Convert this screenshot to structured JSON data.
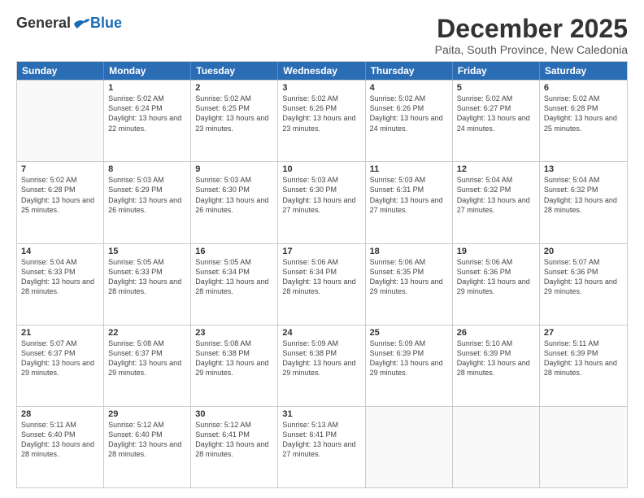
{
  "logo": {
    "general": "General",
    "blue": "Blue"
  },
  "title": "December 2025",
  "subtitle": "Paita, South Province, New Caledonia",
  "days": [
    "Sunday",
    "Monday",
    "Tuesday",
    "Wednesday",
    "Thursday",
    "Friday",
    "Saturday"
  ],
  "weeks": [
    [
      {
        "day": "",
        "sunrise": "",
        "sunset": "",
        "daylight": ""
      },
      {
        "day": "1",
        "sunrise": "Sunrise: 5:02 AM",
        "sunset": "Sunset: 6:24 PM",
        "daylight": "Daylight: 13 hours and 22 minutes."
      },
      {
        "day": "2",
        "sunrise": "Sunrise: 5:02 AM",
        "sunset": "Sunset: 6:25 PM",
        "daylight": "Daylight: 13 hours and 23 minutes."
      },
      {
        "day": "3",
        "sunrise": "Sunrise: 5:02 AM",
        "sunset": "Sunset: 6:26 PM",
        "daylight": "Daylight: 13 hours and 23 minutes."
      },
      {
        "day": "4",
        "sunrise": "Sunrise: 5:02 AM",
        "sunset": "Sunset: 6:26 PM",
        "daylight": "Daylight: 13 hours and 24 minutes."
      },
      {
        "day": "5",
        "sunrise": "Sunrise: 5:02 AM",
        "sunset": "Sunset: 6:27 PM",
        "daylight": "Daylight: 13 hours and 24 minutes."
      },
      {
        "day": "6",
        "sunrise": "Sunrise: 5:02 AM",
        "sunset": "Sunset: 6:28 PM",
        "daylight": "Daylight: 13 hours and 25 minutes."
      }
    ],
    [
      {
        "day": "7",
        "sunrise": "Sunrise: 5:02 AM",
        "sunset": "Sunset: 6:28 PM",
        "daylight": "Daylight: 13 hours and 25 minutes."
      },
      {
        "day": "8",
        "sunrise": "Sunrise: 5:03 AM",
        "sunset": "Sunset: 6:29 PM",
        "daylight": "Daylight: 13 hours and 26 minutes."
      },
      {
        "day": "9",
        "sunrise": "Sunrise: 5:03 AM",
        "sunset": "Sunset: 6:30 PM",
        "daylight": "Daylight: 13 hours and 26 minutes."
      },
      {
        "day": "10",
        "sunrise": "Sunrise: 5:03 AM",
        "sunset": "Sunset: 6:30 PM",
        "daylight": "Daylight: 13 hours and 27 minutes."
      },
      {
        "day": "11",
        "sunrise": "Sunrise: 5:03 AM",
        "sunset": "Sunset: 6:31 PM",
        "daylight": "Daylight: 13 hours and 27 minutes."
      },
      {
        "day": "12",
        "sunrise": "Sunrise: 5:04 AM",
        "sunset": "Sunset: 6:32 PM",
        "daylight": "Daylight: 13 hours and 27 minutes."
      },
      {
        "day": "13",
        "sunrise": "Sunrise: 5:04 AM",
        "sunset": "Sunset: 6:32 PM",
        "daylight": "Daylight: 13 hours and 28 minutes."
      }
    ],
    [
      {
        "day": "14",
        "sunrise": "Sunrise: 5:04 AM",
        "sunset": "Sunset: 6:33 PM",
        "daylight": "Daylight: 13 hours and 28 minutes."
      },
      {
        "day": "15",
        "sunrise": "Sunrise: 5:05 AM",
        "sunset": "Sunset: 6:33 PM",
        "daylight": "Daylight: 13 hours and 28 minutes."
      },
      {
        "day": "16",
        "sunrise": "Sunrise: 5:05 AM",
        "sunset": "Sunset: 6:34 PM",
        "daylight": "Daylight: 13 hours and 28 minutes."
      },
      {
        "day": "17",
        "sunrise": "Sunrise: 5:06 AM",
        "sunset": "Sunset: 6:34 PM",
        "daylight": "Daylight: 13 hours and 28 minutes."
      },
      {
        "day": "18",
        "sunrise": "Sunrise: 5:06 AM",
        "sunset": "Sunset: 6:35 PM",
        "daylight": "Daylight: 13 hours and 29 minutes."
      },
      {
        "day": "19",
        "sunrise": "Sunrise: 5:06 AM",
        "sunset": "Sunset: 6:36 PM",
        "daylight": "Daylight: 13 hours and 29 minutes."
      },
      {
        "day": "20",
        "sunrise": "Sunrise: 5:07 AM",
        "sunset": "Sunset: 6:36 PM",
        "daylight": "Daylight: 13 hours and 29 minutes."
      }
    ],
    [
      {
        "day": "21",
        "sunrise": "Sunrise: 5:07 AM",
        "sunset": "Sunset: 6:37 PM",
        "daylight": "Daylight: 13 hours and 29 minutes."
      },
      {
        "day": "22",
        "sunrise": "Sunrise: 5:08 AM",
        "sunset": "Sunset: 6:37 PM",
        "daylight": "Daylight: 13 hours and 29 minutes."
      },
      {
        "day": "23",
        "sunrise": "Sunrise: 5:08 AM",
        "sunset": "Sunset: 6:38 PM",
        "daylight": "Daylight: 13 hours and 29 minutes."
      },
      {
        "day": "24",
        "sunrise": "Sunrise: 5:09 AM",
        "sunset": "Sunset: 6:38 PM",
        "daylight": "Daylight: 13 hours and 29 minutes."
      },
      {
        "day": "25",
        "sunrise": "Sunrise: 5:09 AM",
        "sunset": "Sunset: 6:39 PM",
        "daylight": "Daylight: 13 hours and 29 minutes."
      },
      {
        "day": "26",
        "sunrise": "Sunrise: 5:10 AM",
        "sunset": "Sunset: 6:39 PM",
        "daylight": "Daylight: 13 hours and 28 minutes."
      },
      {
        "day": "27",
        "sunrise": "Sunrise: 5:11 AM",
        "sunset": "Sunset: 6:39 PM",
        "daylight": "Daylight: 13 hours and 28 minutes."
      }
    ],
    [
      {
        "day": "28",
        "sunrise": "Sunrise: 5:11 AM",
        "sunset": "Sunset: 6:40 PM",
        "daylight": "Daylight: 13 hours and 28 minutes."
      },
      {
        "day": "29",
        "sunrise": "Sunrise: 5:12 AM",
        "sunset": "Sunset: 6:40 PM",
        "daylight": "Daylight: 13 hours and 28 minutes."
      },
      {
        "day": "30",
        "sunrise": "Sunrise: 5:12 AM",
        "sunset": "Sunset: 6:41 PM",
        "daylight": "Daylight: 13 hours and 28 minutes."
      },
      {
        "day": "31",
        "sunrise": "Sunrise: 5:13 AM",
        "sunset": "Sunset: 6:41 PM",
        "daylight": "Daylight: 13 hours and 27 minutes."
      },
      {
        "day": "",
        "sunrise": "",
        "sunset": "",
        "daylight": ""
      },
      {
        "day": "",
        "sunrise": "",
        "sunset": "",
        "daylight": ""
      },
      {
        "day": "",
        "sunrise": "",
        "sunset": "",
        "daylight": ""
      }
    ]
  ]
}
